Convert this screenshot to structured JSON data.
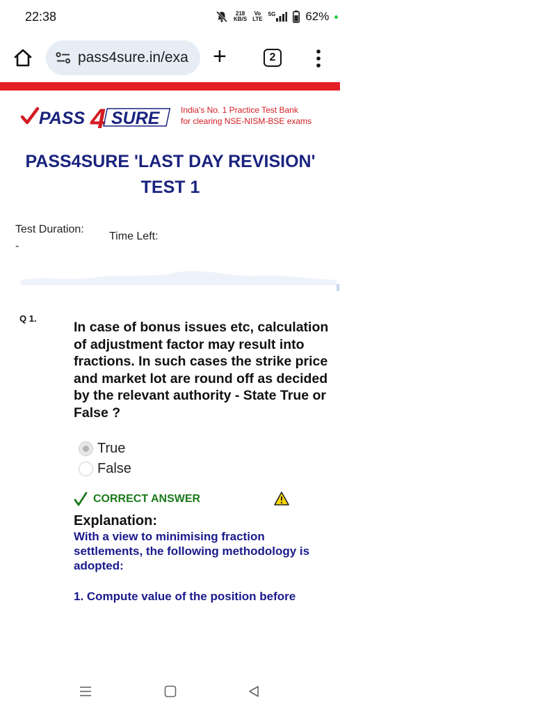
{
  "status_bar": {
    "time": "22:38",
    "net_speed_top": "218",
    "net_speed_unit": "KB/S",
    "volte_top": "Vo",
    "volte_bottom": "LTE",
    "signal_label": "5G",
    "battery_percent": "62%",
    "icons": [
      "bell-muted-icon",
      "signal-icon",
      "battery-icon"
    ]
  },
  "browser": {
    "url": "pass4sure.in/exa",
    "tab_count": "2",
    "icons": [
      "home-icon",
      "site-settings-icon",
      "new-tab-icon",
      "tabs-icon",
      "more-menu-icon"
    ]
  },
  "header": {
    "logo_text_pre": "PASS",
    "logo_text_digit": "4",
    "logo_text_post": "SURE",
    "tagline_line1": "India's No. 1 Practice Test Bank",
    "tagline_line2": "for clearing NSE-NISM-BSE exams",
    "brand_red": "#e31e24",
    "brand_navy": "#1a237e"
  },
  "page": {
    "title": "PASS4SURE 'LAST DAY REVISION' TEST 1",
    "test_duration_label": "Test Duration:",
    "test_duration_value": "-",
    "time_left_label": "Time Left:"
  },
  "question": {
    "number": "Q 1.",
    "text": "In case of bonus issues etc, calculation of adjustment factor may result into fractions. In such cases the strike price and market lot are round off as decided by the relevant authority - State True or False ?",
    "options": [
      {
        "label": "True",
        "selected": true
      },
      {
        "label": "False",
        "selected": false
      }
    ],
    "result_label": "CORRECT ANSWER",
    "explanation_heading": "Explanation:",
    "explanation_text": "With a view to minimising fraction settlements, the following methodology is adopted:",
    "explanation_step": "1. Compute value of the position before"
  },
  "nav_bar": {
    "icons": [
      "recent-apps-icon",
      "home-nav-icon",
      "back-icon"
    ]
  }
}
